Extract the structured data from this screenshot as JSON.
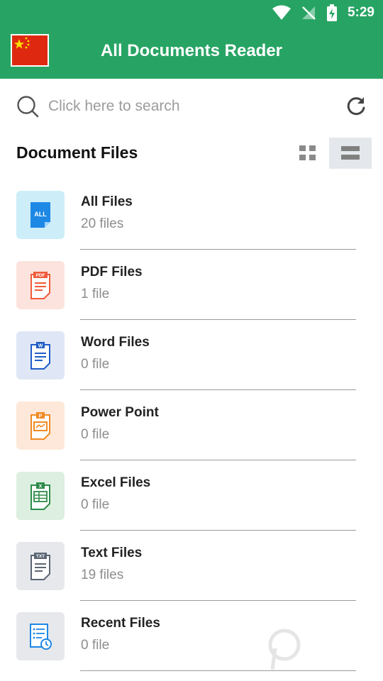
{
  "status": {
    "time": "5:29"
  },
  "header": {
    "title": "All Documents Reader",
    "flag": "china-flag"
  },
  "search": {
    "placeholder": "Click here to search"
  },
  "section": {
    "title": "Document Files"
  },
  "items": [
    {
      "title": "All Files",
      "count": "20 files",
      "badge": "ALL",
      "tile_bg": "#cdeef8",
      "accent": "#1e88e5"
    },
    {
      "title": "PDF Files",
      "count": "1 file",
      "badge": "PDF",
      "tile_bg": "#fde3dd",
      "accent": "#f15a3a"
    },
    {
      "title": "Word Files",
      "count": "0 file",
      "badge": "W",
      "tile_bg": "#dfe7f6",
      "accent": "#1f5cc5"
    },
    {
      "title": "Power Point",
      "count": "0 file",
      "badge": "P",
      "tile_bg": "#fde8d9",
      "accent": "#f08a24"
    },
    {
      "title": "Excel Files",
      "count": "0 file",
      "badge": "X",
      "tile_bg": "#dcefe1",
      "accent": "#2e8b4a"
    },
    {
      "title": "Text Files",
      "count": "19 files",
      "badge": "TXT",
      "tile_bg": "#e6e8ec",
      "accent": "#5b6573"
    },
    {
      "title": "Recent Files",
      "count": "0 file",
      "badge": "",
      "tile_bg": "#e6e8ec",
      "accent": "#1e88e5"
    }
  ],
  "colors": {
    "primary": "#27a464",
    "muted_text": "#8d8d8d"
  }
}
